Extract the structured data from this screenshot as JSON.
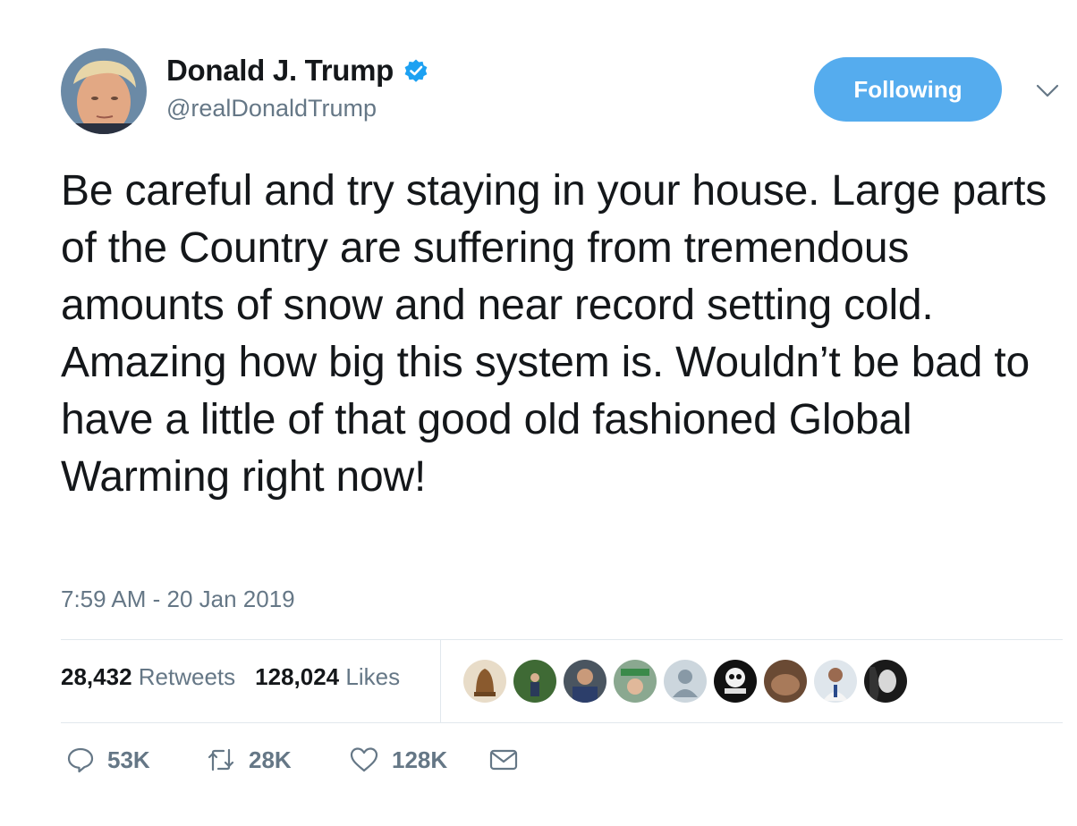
{
  "author": {
    "display_name": "Donald J. Trump",
    "handle": "@realDonaldTrump",
    "verified_icon": "verified-badge-icon"
  },
  "follow_button": {
    "label": "Following"
  },
  "tweet": {
    "text": "Be careful and try staying in your house. Large parts of the Country are suffering from tremendous amounts of snow and near record setting cold. Amazing how big this system is. Wouldn’t be bad to have a little of that good old fashioned Global Warming right now!",
    "timestamp": "7:59 AM - 20 Jan 2019"
  },
  "stats": {
    "retweets_count": "28,432",
    "retweets_label": "Retweets",
    "likes_count": "128,024",
    "likes_label": "Likes"
  },
  "actions": {
    "replies": "53K",
    "retweets": "28K",
    "likes": "128K"
  },
  "colors": {
    "accent": "#55acee",
    "text": "#14171a",
    "muted": "#657786",
    "divider": "#e1e8ed"
  }
}
